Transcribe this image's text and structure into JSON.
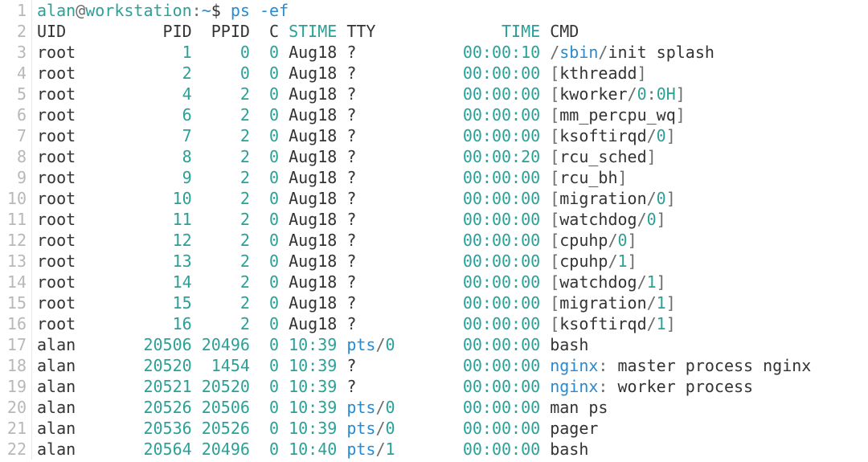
{
  "prompt": {
    "user": "alan",
    "at": "@",
    "host": "workstation",
    "colon": ":",
    "path": "~",
    "dollar": "$",
    "command": "ps",
    "flag": "-ef"
  },
  "header": {
    "uid": "UID",
    "pid": "PID",
    "ppid": "PPID",
    "c": "C",
    "stime": "STIME",
    "tty": "TTY",
    "time": "TIME",
    "cmd": "CMD"
  },
  "rows": [
    {
      "uid": "root",
      "pid": "1",
      "ppid": "0",
      "c": "0",
      "stime": "Aug18",
      "stime_hl": false,
      "tty": "?",
      "tty_hl": false,
      "time": "00:00:10",
      "cmd_parts": [
        {
          "t": "/",
          "c": "punct"
        },
        {
          "t": "sbin",
          "c": "blue"
        },
        {
          "t": "/",
          "c": "punct"
        },
        {
          "t": "init splash",
          "c": "black"
        }
      ]
    },
    {
      "uid": "root",
      "pid": "2",
      "ppid": "0",
      "c": "0",
      "stime": "Aug18",
      "stime_hl": false,
      "tty": "?",
      "tty_hl": false,
      "time": "00:00:00",
      "cmd_parts": [
        {
          "t": "[",
          "c": "punct"
        },
        {
          "t": "kthreadd",
          "c": "black"
        },
        {
          "t": "]",
          "c": "punct"
        }
      ]
    },
    {
      "uid": "root",
      "pid": "4",
      "ppid": "2",
      "c": "0",
      "stime": "Aug18",
      "stime_hl": false,
      "tty": "?",
      "tty_hl": false,
      "time": "00:00:00",
      "cmd_parts": [
        {
          "t": "[",
          "c": "punct"
        },
        {
          "t": "kworker",
          "c": "black"
        },
        {
          "t": "/",
          "c": "punct"
        },
        {
          "t": "0",
          "c": "teal"
        },
        {
          "t": ":",
          "c": "punct"
        },
        {
          "t": "0H",
          "c": "teal"
        },
        {
          "t": "]",
          "c": "punct"
        }
      ]
    },
    {
      "uid": "root",
      "pid": "6",
      "ppid": "2",
      "c": "0",
      "stime": "Aug18",
      "stime_hl": false,
      "tty": "?",
      "tty_hl": false,
      "time": "00:00:00",
      "cmd_parts": [
        {
          "t": "[",
          "c": "punct"
        },
        {
          "t": "mm_percpu_wq",
          "c": "black"
        },
        {
          "t": "]",
          "c": "punct"
        }
      ]
    },
    {
      "uid": "root",
      "pid": "7",
      "ppid": "2",
      "c": "0",
      "stime": "Aug18",
      "stime_hl": false,
      "tty": "?",
      "tty_hl": false,
      "time": "00:00:00",
      "cmd_parts": [
        {
          "t": "[",
          "c": "punct"
        },
        {
          "t": "ksoftirqd",
          "c": "black"
        },
        {
          "t": "/",
          "c": "punct"
        },
        {
          "t": "0",
          "c": "teal"
        },
        {
          "t": "]",
          "c": "punct"
        }
      ]
    },
    {
      "uid": "root",
      "pid": "8",
      "ppid": "2",
      "c": "0",
      "stime": "Aug18",
      "stime_hl": false,
      "tty": "?",
      "tty_hl": false,
      "time": "00:00:20",
      "cmd_parts": [
        {
          "t": "[",
          "c": "punct"
        },
        {
          "t": "rcu_sched",
          "c": "black"
        },
        {
          "t": "]",
          "c": "punct"
        }
      ]
    },
    {
      "uid": "root",
      "pid": "9",
      "ppid": "2",
      "c": "0",
      "stime": "Aug18",
      "stime_hl": false,
      "tty": "?",
      "tty_hl": false,
      "time": "00:00:00",
      "cmd_parts": [
        {
          "t": "[",
          "c": "punct"
        },
        {
          "t": "rcu_bh",
          "c": "black"
        },
        {
          "t": "]",
          "c": "punct"
        }
      ]
    },
    {
      "uid": "root",
      "pid": "10",
      "ppid": "2",
      "c": "0",
      "stime": "Aug18",
      "stime_hl": false,
      "tty": "?",
      "tty_hl": false,
      "time": "00:00:00",
      "cmd_parts": [
        {
          "t": "[",
          "c": "punct"
        },
        {
          "t": "migration",
          "c": "black"
        },
        {
          "t": "/",
          "c": "punct"
        },
        {
          "t": "0",
          "c": "teal"
        },
        {
          "t": "]",
          "c": "punct"
        }
      ]
    },
    {
      "uid": "root",
      "pid": "11",
      "ppid": "2",
      "c": "0",
      "stime": "Aug18",
      "stime_hl": false,
      "tty": "?",
      "tty_hl": false,
      "time": "00:00:00",
      "cmd_parts": [
        {
          "t": "[",
          "c": "punct"
        },
        {
          "t": "watchdog",
          "c": "black"
        },
        {
          "t": "/",
          "c": "punct"
        },
        {
          "t": "0",
          "c": "teal"
        },
        {
          "t": "]",
          "c": "punct"
        }
      ]
    },
    {
      "uid": "root",
      "pid": "12",
      "ppid": "2",
      "c": "0",
      "stime": "Aug18",
      "stime_hl": false,
      "tty": "?",
      "tty_hl": false,
      "time": "00:00:00",
      "cmd_parts": [
        {
          "t": "[",
          "c": "punct"
        },
        {
          "t": "cpuhp",
          "c": "black"
        },
        {
          "t": "/",
          "c": "punct"
        },
        {
          "t": "0",
          "c": "teal"
        },
        {
          "t": "]",
          "c": "punct"
        }
      ]
    },
    {
      "uid": "root",
      "pid": "13",
      "ppid": "2",
      "c": "0",
      "stime": "Aug18",
      "stime_hl": false,
      "tty": "?",
      "tty_hl": false,
      "time": "00:00:00",
      "cmd_parts": [
        {
          "t": "[",
          "c": "punct"
        },
        {
          "t": "cpuhp",
          "c": "black"
        },
        {
          "t": "/",
          "c": "punct"
        },
        {
          "t": "1",
          "c": "teal"
        },
        {
          "t": "]",
          "c": "punct"
        }
      ]
    },
    {
      "uid": "root",
      "pid": "14",
      "ppid": "2",
      "c": "0",
      "stime": "Aug18",
      "stime_hl": false,
      "tty": "?",
      "tty_hl": false,
      "time": "00:00:00",
      "cmd_parts": [
        {
          "t": "[",
          "c": "punct"
        },
        {
          "t": "watchdog",
          "c": "black"
        },
        {
          "t": "/",
          "c": "punct"
        },
        {
          "t": "1",
          "c": "teal"
        },
        {
          "t": "]",
          "c": "punct"
        }
      ]
    },
    {
      "uid": "root",
      "pid": "15",
      "ppid": "2",
      "c": "0",
      "stime": "Aug18",
      "stime_hl": false,
      "tty": "?",
      "tty_hl": false,
      "time": "00:00:00",
      "cmd_parts": [
        {
          "t": "[",
          "c": "punct"
        },
        {
          "t": "migration",
          "c": "black"
        },
        {
          "t": "/",
          "c": "punct"
        },
        {
          "t": "1",
          "c": "teal"
        },
        {
          "t": "]",
          "c": "punct"
        }
      ]
    },
    {
      "uid": "root",
      "pid": "16",
      "ppid": "2",
      "c": "0",
      "stime": "Aug18",
      "stime_hl": false,
      "tty": "?",
      "tty_hl": false,
      "time": "00:00:00",
      "cmd_parts": [
        {
          "t": "[",
          "c": "punct"
        },
        {
          "t": "ksoftirqd",
          "c": "black"
        },
        {
          "t": "/",
          "c": "punct"
        },
        {
          "t": "1",
          "c": "teal"
        },
        {
          "t": "]",
          "c": "punct"
        }
      ]
    },
    {
      "uid": "alan",
      "pid": "20506",
      "ppid": "20496",
      "c": "0",
      "stime": "10:39",
      "stime_hl": true,
      "tty": "pts/0",
      "tty_hl": true,
      "time": "00:00:00",
      "cmd_parts": [
        {
          "t": "bash",
          "c": "black"
        }
      ]
    },
    {
      "uid": "alan",
      "pid": "20520",
      "ppid": "1454",
      "c": "0",
      "stime": "10:39",
      "stime_hl": true,
      "tty": "?",
      "tty_hl": false,
      "time": "00:00:00",
      "cmd_parts": [
        {
          "t": "nginx",
          "c": "blue"
        },
        {
          "t": ":",
          "c": "punct"
        },
        {
          "t": " master process nginx",
          "c": "black"
        }
      ]
    },
    {
      "uid": "alan",
      "pid": "20521",
      "ppid": "20520",
      "c": "0",
      "stime": "10:39",
      "stime_hl": true,
      "tty": "?",
      "tty_hl": false,
      "time": "00:00:00",
      "cmd_parts": [
        {
          "t": "nginx",
          "c": "blue"
        },
        {
          "t": ":",
          "c": "punct"
        },
        {
          "t": " worker process",
          "c": "black"
        }
      ]
    },
    {
      "uid": "alan",
      "pid": "20526",
      "ppid": "20506",
      "c": "0",
      "stime": "10:39",
      "stime_hl": true,
      "tty": "pts/0",
      "tty_hl": true,
      "time": "00:00:00",
      "cmd_parts": [
        {
          "t": "man ps",
          "c": "black"
        }
      ]
    },
    {
      "uid": "alan",
      "pid": "20536",
      "ppid": "20526",
      "c": "0",
      "stime": "10:39",
      "stime_hl": true,
      "tty": "pts/0",
      "tty_hl": true,
      "time": "00:00:00",
      "cmd_parts": [
        {
          "t": "pager",
          "c": "black"
        }
      ]
    },
    {
      "uid": "alan",
      "pid": "20564",
      "ppid": "20496",
      "c": "0",
      "stime": "10:40",
      "stime_hl": true,
      "tty": "pts/1",
      "tty_hl": true,
      "time": "00:00:00",
      "cmd_parts": [
        {
          "t": "bash",
          "c": "black"
        }
      ]
    }
  ],
  "widths": {
    "uid": 8,
    "pid": 8,
    "ppid": 6,
    "c": 3,
    "stime": 6,
    "tty": 9,
    "time": 11
  },
  "line_count": 22
}
